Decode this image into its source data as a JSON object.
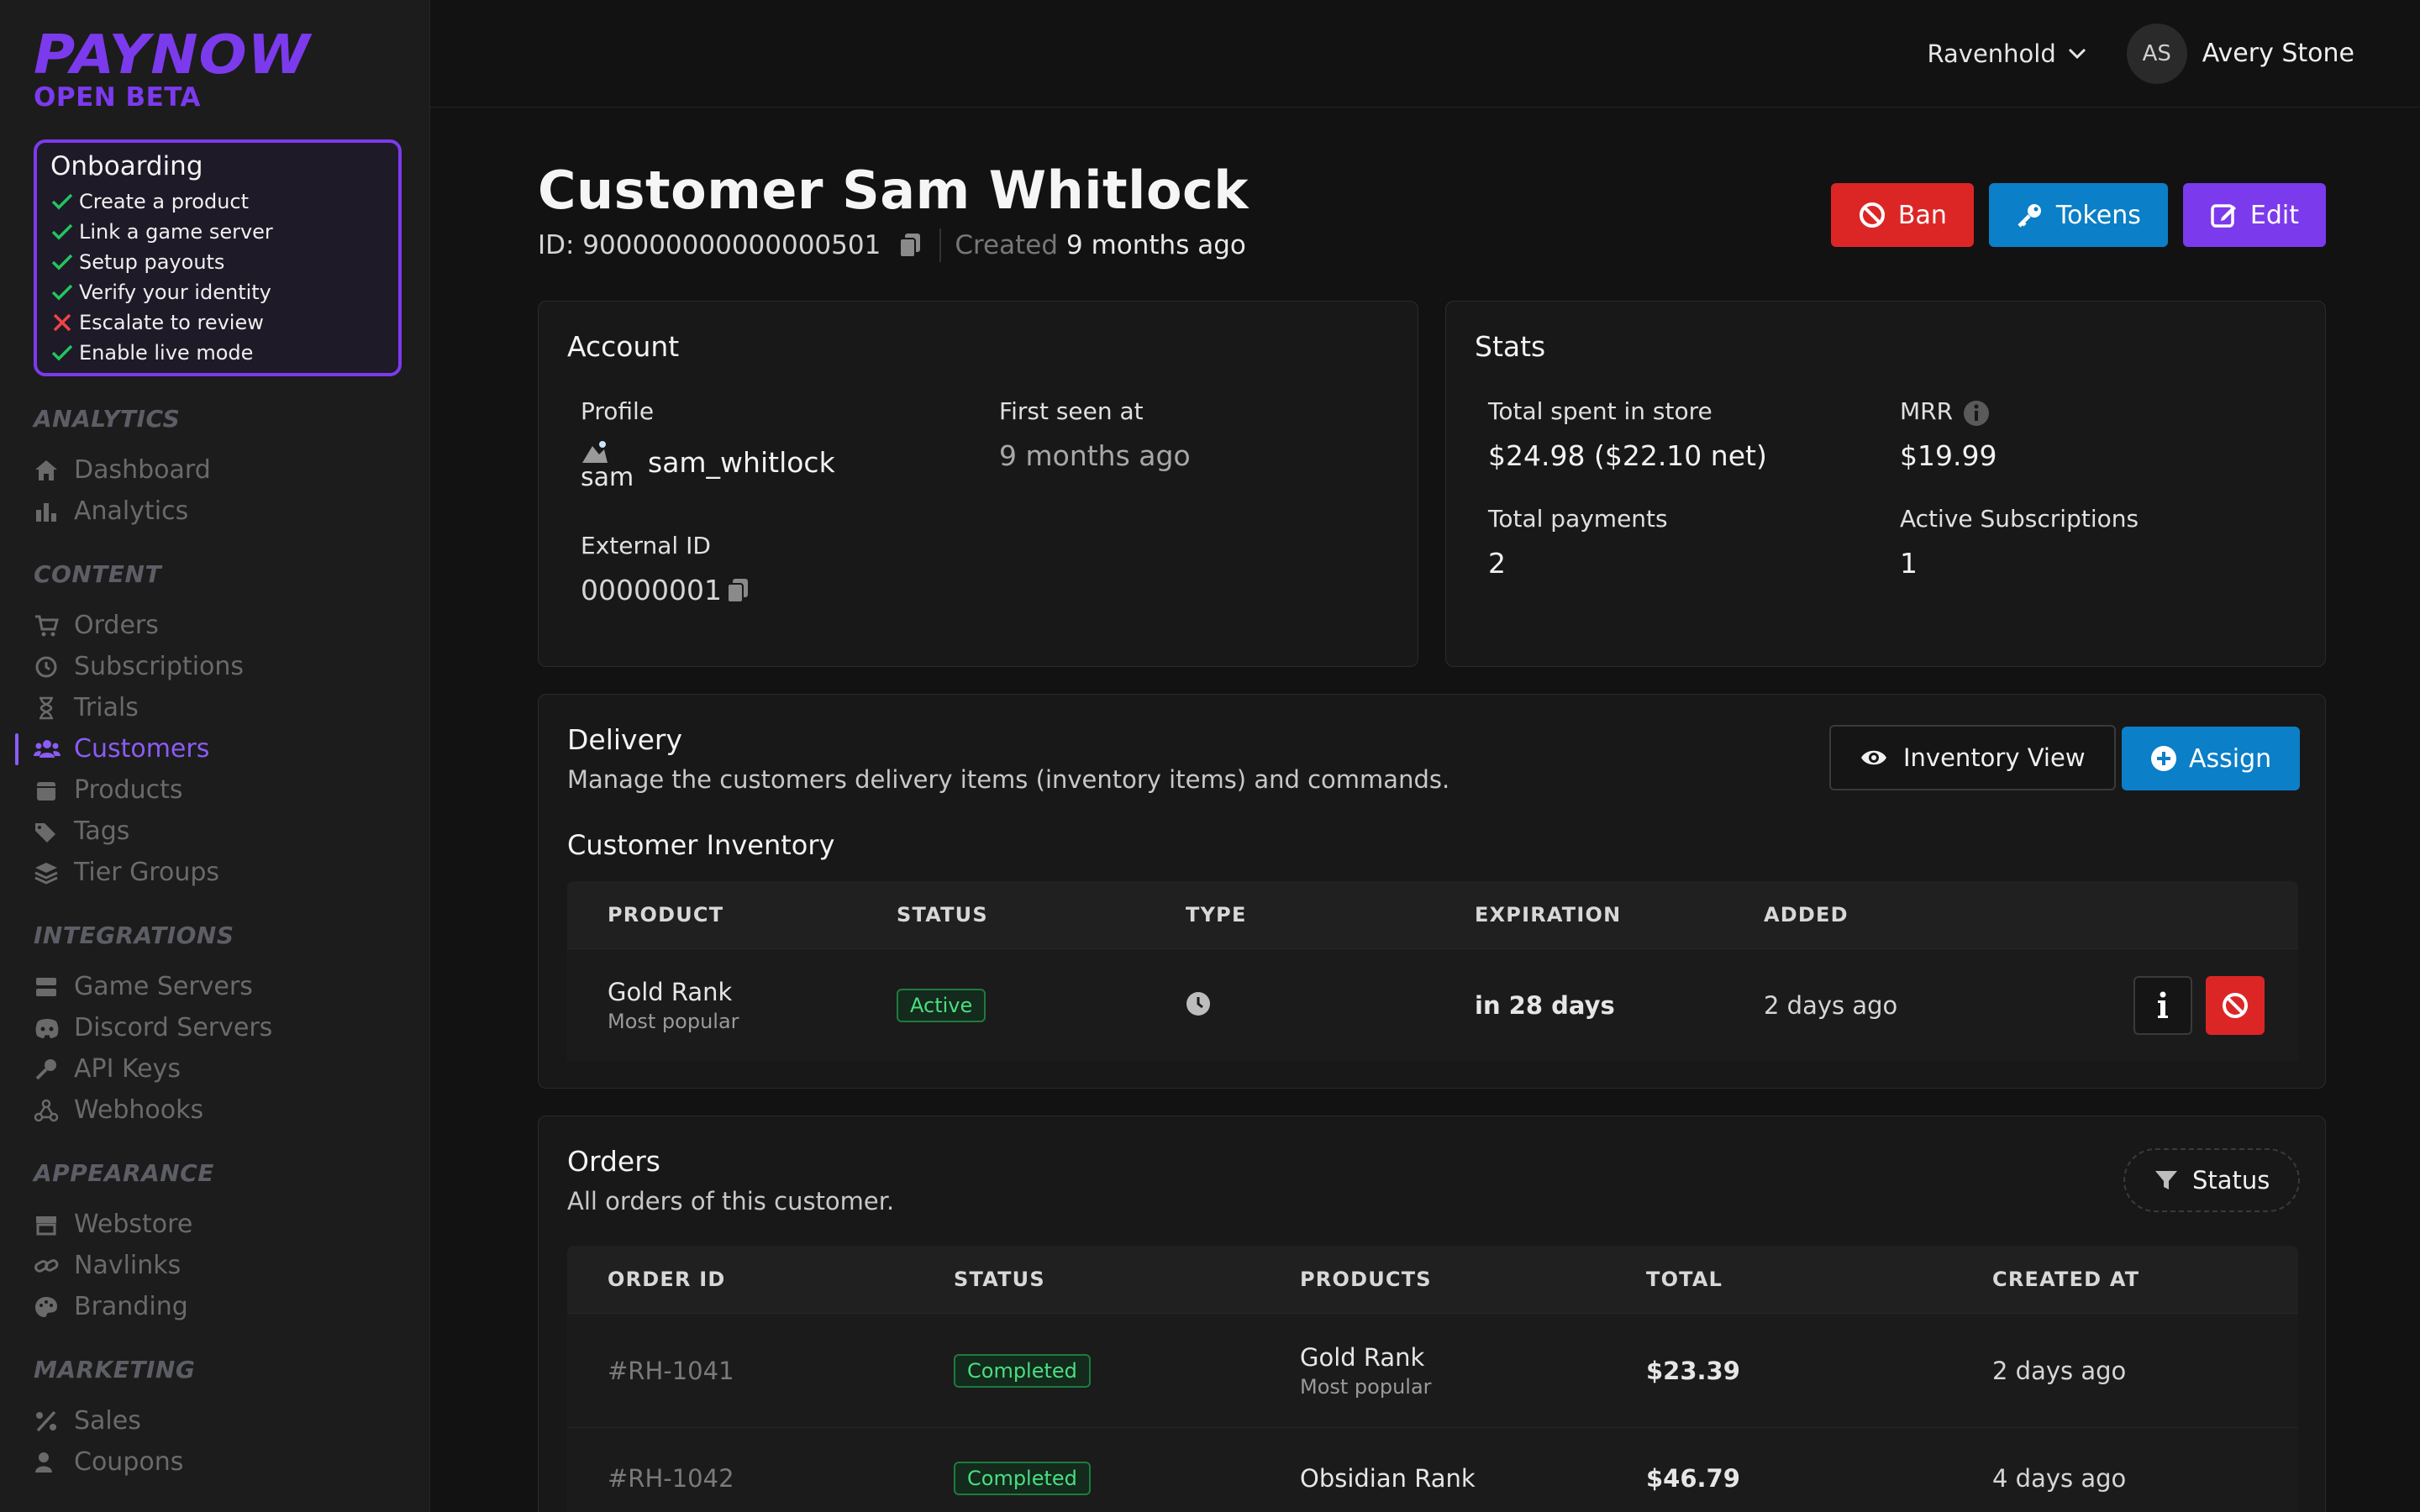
{
  "brand": {
    "name": "PAYNOW",
    "tagline": "OPEN BETA",
    "color": "#7c3aed"
  },
  "onboarding": {
    "title": "Onboarding",
    "items": [
      {
        "label": "Create a product",
        "done": true
      },
      {
        "label": "Link a game server",
        "done": true
      },
      {
        "label": "Setup payouts",
        "done": true
      },
      {
        "label": "Verify your identity",
        "done": true
      },
      {
        "label": "Escalate to review",
        "done": false
      },
      {
        "label": "Enable live mode",
        "done": true
      }
    ]
  },
  "sidebar": {
    "analytics": {
      "title": "ANALYTICS",
      "items": [
        "Dashboard",
        "Analytics"
      ]
    },
    "content": {
      "title": "CONTENT",
      "items": [
        "Orders",
        "Subscriptions",
        "Trials",
        "Customers",
        "Products",
        "Tags",
        "Tier Groups"
      ]
    },
    "integrations": {
      "title": "INTEGRATIONS",
      "items": [
        "Game Servers",
        "Discord Servers",
        "API Keys",
        "Webhooks"
      ]
    },
    "appearance": {
      "title": "APPEARANCE",
      "items": [
        "Webstore",
        "Navlinks",
        "Branding"
      ]
    },
    "marketing": {
      "title": "MARKETING",
      "items": [
        "Sales",
        "Coupons"
      ]
    },
    "active": "Customers"
  },
  "topbar": {
    "store": "Ravenhold",
    "user_initials": "AS",
    "user_name": "Avery Stone"
  },
  "page": {
    "title": "Customer Sam Whitlock",
    "id_text": "ID: 900000000000000501",
    "created_label": "Created",
    "created_value": "9 months ago",
    "actions": {
      "ban": "Ban",
      "tokens": "Tokens",
      "edit": "Edit"
    }
  },
  "account": {
    "title": "Account",
    "profile_label": "Profile",
    "avatar_alt": "sam",
    "username": "sam_whitlock",
    "first_seen_label": "First seen at",
    "first_seen_value": "9 months ago",
    "external_id_label": "External ID",
    "external_id_value": "00000001"
  },
  "stats": {
    "title": "Stats",
    "total_spent_label": "Total spent in store",
    "total_spent_value": "$24.98 ($22.10 net)",
    "mrr_label": "MRR",
    "mrr_value": "$19.99",
    "total_payments_label": "Total payments",
    "total_payments_value": "2",
    "active_subs_label": "Active Subscriptions",
    "active_subs_value": "1"
  },
  "delivery": {
    "title": "Delivery",
    "description": "Manage the customers delivery items (inventory items) and commands.",
    "inventory_view": "Inventory View",
    "assign": "Assign",
    "inventory_title": "Customer Inventory",
    "columns": [
      "PRODUCT",
      "STATUS",
      "TYPE",
      "EXPIRATION",
      "ADDED"
    ],
    "rows": [
      {
        "product": "Gold Rank",
        "product_sub": "Most popular",
        "status": "Active",
        "type_icon": "clock-icon",
        "expiration": "in 28 days",
        "added": "2 days ago"
      }
    ]
  },
  "orders": {
    "title": "Orders",
    "description": "All orders of this customer.",
    "filter": "Status",
    "columns": [
      "ORDER ID",
      "STATUS",
      "PRODUCTS",
      "TOTAL",
      "CREATED AT"
    ],
    "rows": [
      {
        "id": "#RH-1041",
        "status": "Completed",
        "product": "Gold Rank",
        "product_sub": "Most popular",
        "total": "$23.39",
        "created": "2 days ago"
      },
      {
        "id": "#RH-1042",
        "status": "Completed",
        "product": "Obsidian Rank",
        "product_sub": "",
        "total": "$46.79",
        "created": "4 days ago"
      }
    ]
  }
}
